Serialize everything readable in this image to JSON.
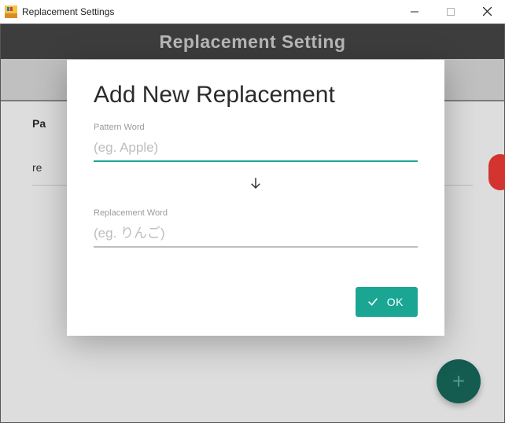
{
  "window": {
    "title": "Replacement Settings"
  },
  "app": {
    "header_title": "Replacement Setting",
    "bg_label": "Pa",
    "bg_row": "re"
  },
  "fab": {
    "glyph": "+"
  },
  "dialog": {
    "title": "Add New Replacement",
    "pattern_label": "Pattern Word",
    "pattern_placeholder": "(eg. Apple)",
    "pattern_value": "",
    "replacement_label": "Replacement Word",
    "replacement_placeholder": "(eg. りんご)",
    "replacement_value": "",
    "ok_label": "OK"
  }
}
